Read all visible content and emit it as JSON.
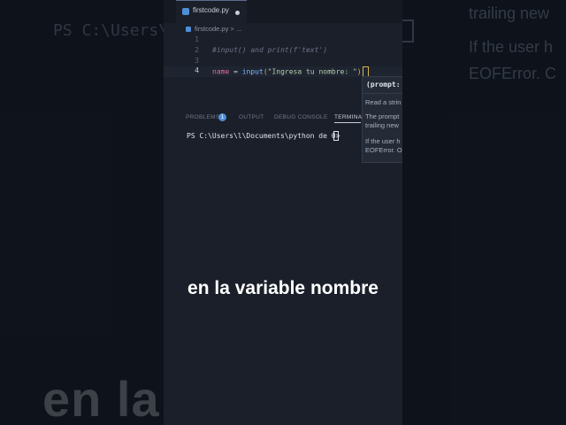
{
  "background": {
    "prompt_text": "PS C:\\Users\\",
    "right_text_1": "trailing new",
    "right_text_2": "If the user h",
    "right_text_3": "EOFError. C",
    "big_caption": "en la                  ombre"
  },
  "tab": {
    "filename": "firstcode.py"
  },
  "breadcrumb": "firstcode.py > ...",
  "editor": {
    "lines": [
      {
        "number": "1",
        "code": ""
      },
      {
        "number": "2",
        "code": "#input() and print(f'text')"
      },
      {
        "number": "3",
        "code": ""
      },
      {
        "number": "4",
        "var": "name",
        "op": " = ",
        "fn": "input",
        "open": "(",
        "str": "\"Ingresa tu nombre: \"",
        "close": ")"
      }
    ]
  },
  "hover": {
    "signature": "(prompt:",
    "p1": "Read a strin",
    "p2": "The prompt",
    "p3": "trailing new",
    "p4": "If the user h",
    "p5": "EOFError. O"
  },
  "panel": {
    "tabs": [
      "PROBLEMS",
      "OUTPUT",
      "DEBUG CONSOLE",
      "TERMINA"
    ],
    "problems_count": "1",
    "terminal_prompt": "PS C:\\Users\\l\\Documents\\python de 0>"
  },
  "caption": "en la variable nombre",
  "colors": {
    "accent": "#4e8fd6",
    "string": "#b5cea8",
    "function": "#79b8ff",
    "variable": "#e06c9f"
  }
}
